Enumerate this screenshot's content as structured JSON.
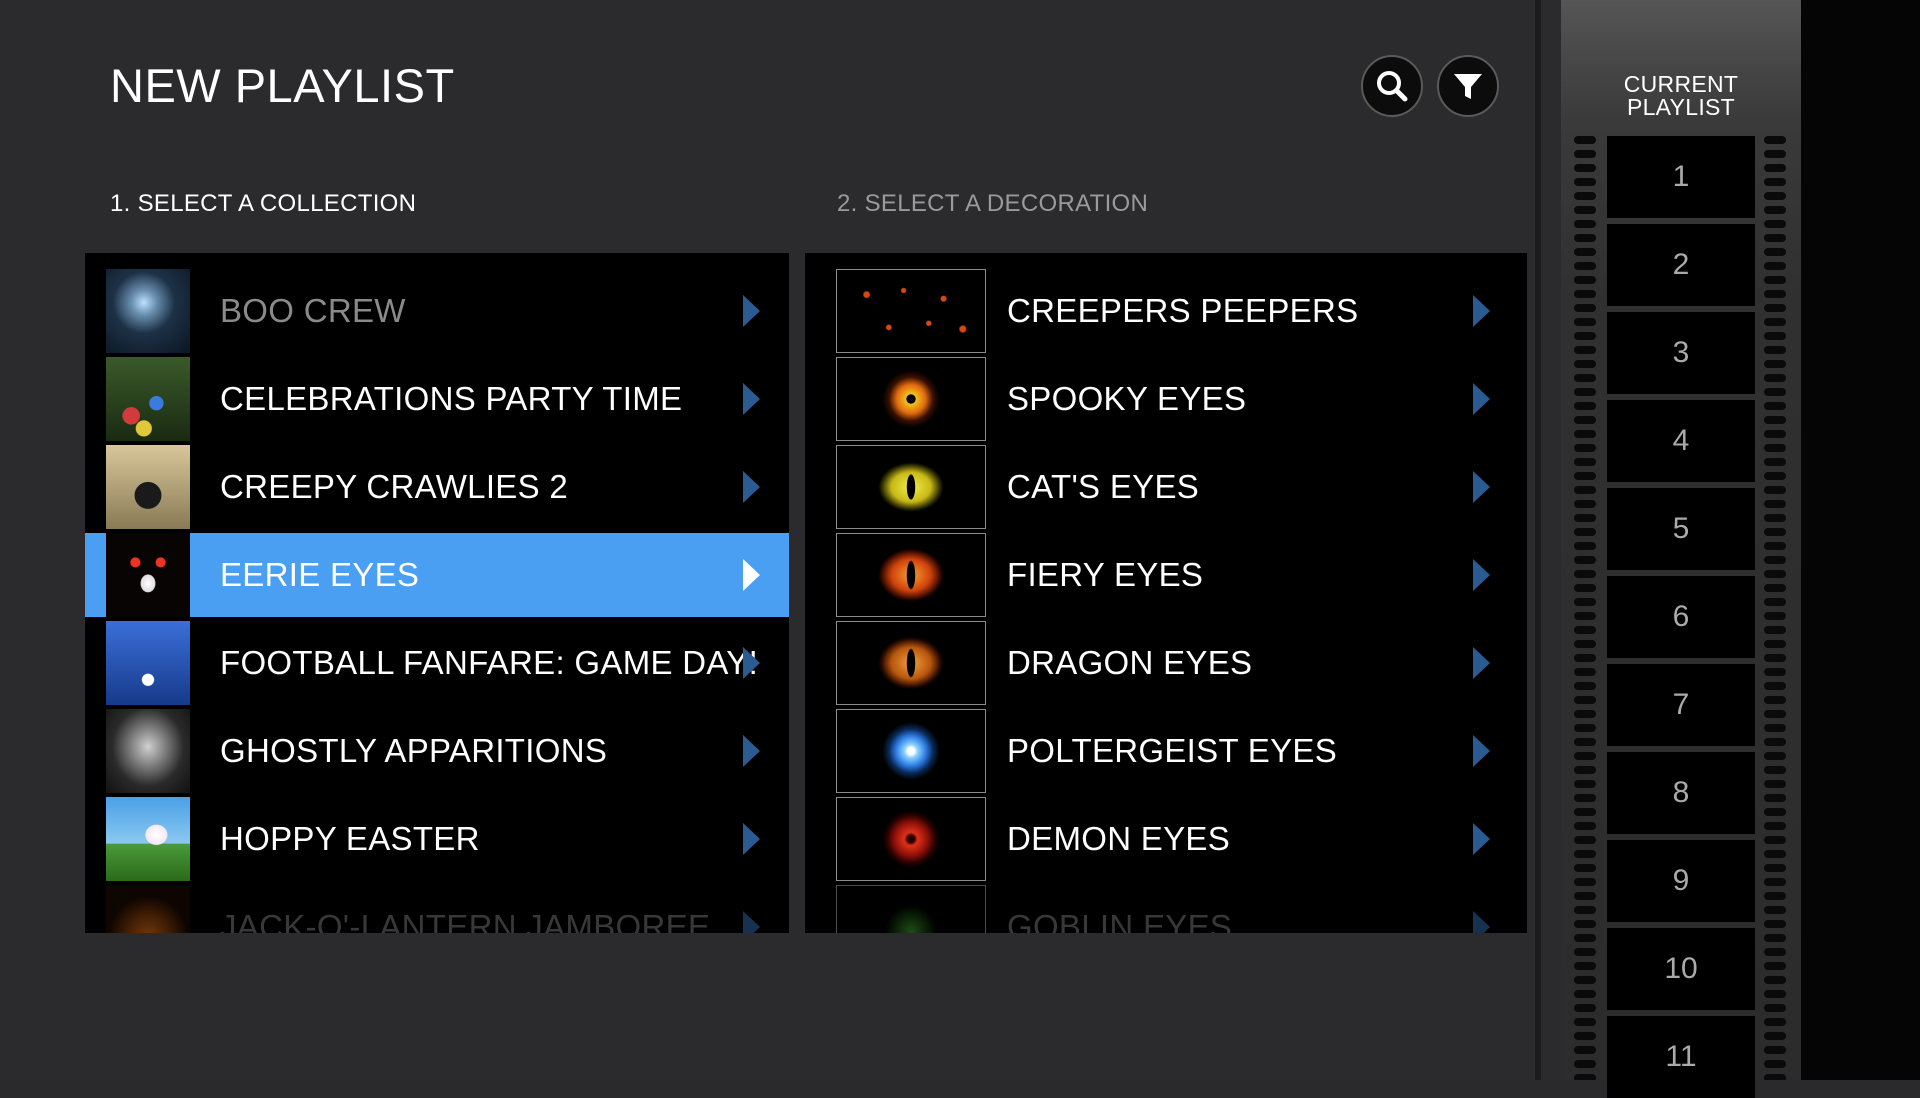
{
  "header": {
    "title": "NEW PLAYLIST",
    "search_icon": "search-icon",
    "filter_icon": "filter-icon"
  },
  "sections": {
    "collection_label": "1. SELECT A COLLECTION",
    "decoration_label": "2. SELECT A DECORATION"
  },
  "collections": [
    {
      "label": "BOO CREW",
      "state": "dim"
    },
    {
      "label": "CELEBRATIONS PARTY TIME",
      "state": "normal"
    },
    {
      "label": "CREEPY CRAWLIES 2",
      "state": "normal"
    },
    {
      "label": "EERIE EYES",
      "state": "selected"
    },
    {
      "label": "FOOTBALL FANFARE: GAME DAY!",
      "state": "normal"
    },
    {
      "label": "GHOSTLY APPARITIONS",
      "state": "normal"
    },
    {
      "label": "HOPPY EASTER",
      "state": "normal"
    },
    {
      "label": "JACK-O'-LANTERN JAMBOREE",
      "state": "faded"
    }
  ],
  "decorations": [
    {
      "label": "CREEPERS PEEPERS",
      "eye_color": "#d64a12"
    },
    {
      "label": "SPOOKY EYES",
      "eye_color": "#f2b21a"
    },
    {
      "label": "CAT'S EYES",
      "eye_color": "#e8e23a"
    },
    {
      "label": "FIERY EYES",
      "eye_color": "#e06a14"
    },
    {
      "label": "DRAGON EYES",
      "eye_color": "#d9821e"
    },
    {
      "label": "POLTERGEIST EYES",
      "eye_color": "#3aa6ff"
    },
    {
      "label": "DEMON EYES",
      "eye_color": "#c2210f"
    },
    {
      "label": "GOBLIN EYES",
      "eye_color": "#3a8a2a"
    }
  ],
  "current_playlist": {
    "title_line1": "CURRENT",
    "title_line2": "PLAYLIST",
    "slots": [
      "1",
      "2",
      "3",
      "4",
      "5",
      "6",
      "7",
      "8",
      "9",
      "10",
      "11"
    ]
  },
  "colors": {
    "selected_row": "#4b9ff2",
    "chevron": "#2a5b92",
    "background": "#2b2b2d"
  }
}
